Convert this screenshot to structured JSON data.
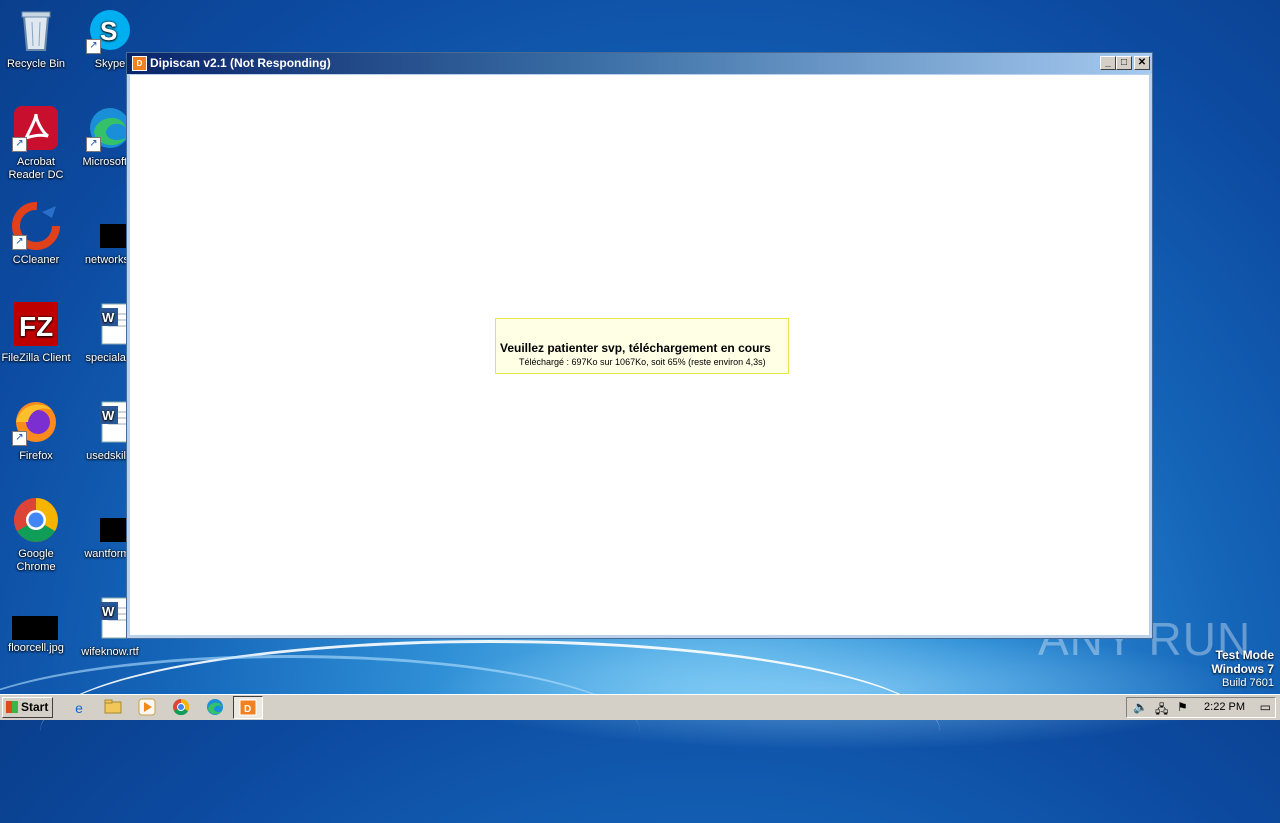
{
  "desktop": {
    "icons": [
      {
        "label": "Recycle Bin",
        "icon": "recycle-bin-icon"
      },
      {
        "label": "Skype",
        "icon": "skype-icon"
      },
      {
        "label": "Acrobat Reader DC",
        "icon": "acrobat-icon"
      },
      {
        "label": "Microsoft E",
        "icon": "edge-icon"
      },
      {
        "label": "CCleaner",
        "icon": "ccleaner-icon"
      },
      {
        "label": "networksa",
        "icon": "file-icon"
      },
      {
        "label": "FileZilla Client",
        "icon": "filezilla-icon"
      },
      {
        "label": "specialact",
        "icon": "word-doc-icon"
      },
      {
        "label": "Firefox",
        "icon": "firefox-icon"
      },
      {
        "label": "usedskills",
        "icon": "word-doc-icon"
      },
      {
        "label": "Google Chrome",
        "icon": "chrome-icon"
      },
      {
        "label": "wantforme",
        "icon": "file-icon"
      },
      {
        "label": "floorcell.jpg",
        "icon": "image-file-icon"
      },
      {
        "label": "wifeknow.rtf",
        "icon": "word-doc-icon"
      }
    ],
    "watermark": "ANY RUN",
    "test_mode": {
      "line1": "Test Mode",
      "line2": "Windows 7",
      "line3": "Build 7601"
    }
  },
  "window": {
    "title": "Dipiscan v2.1 (Not Responding)",
    "app_icon_text": "D",
    "controls": {
      "minimize": "_",
      "maximize": "□",
      "close": "✕"
    },
    "dialog": {
      "message": "Veuillez patienter svp, téléchargement en cours",
      "detail": "Téléchargé : 697Ko sur 1067Ko, soit 65% (reste environ 4,3s)"
    }
  },
  "taskbar": {
    "start_label": "Start",
    "pinned": [
      "ie-icon",
      "explorer-icon",
      "media-player-icon",
      "chrome-icon",
      "edge-icon",
      "dipiscan-icon"
    ],
    "clock": "2:22 PM"
  }
}
